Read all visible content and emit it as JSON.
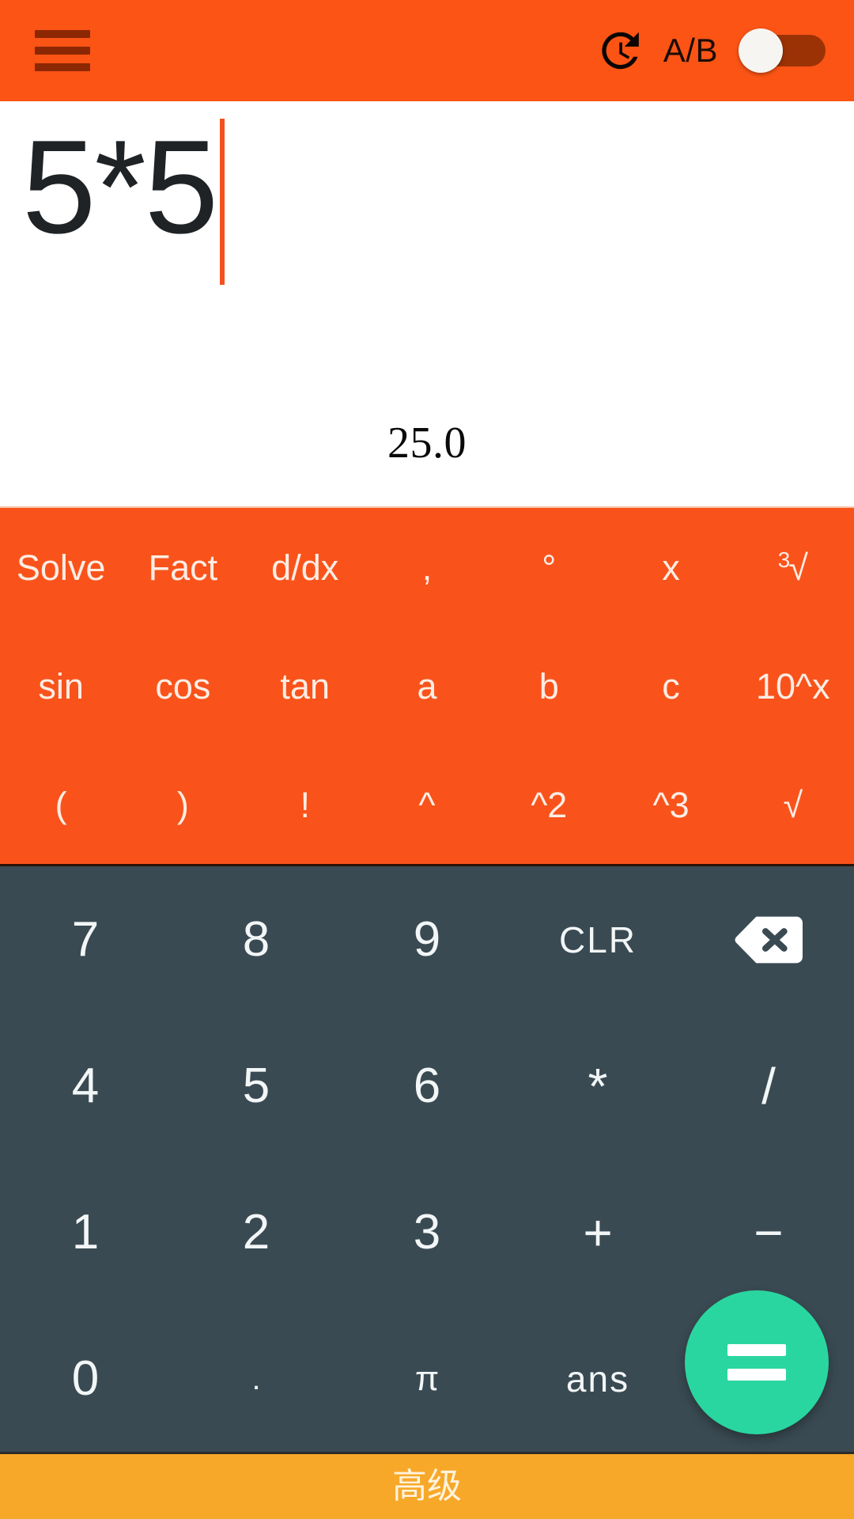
{
  "header": {
    "menu_icon": "hamburger-menu-icon",
    "history_icon": "history-clock-icon",
    "ab_label": "A/B",
    "toggle_state": "off",
    "background_color": "#FB5415",
    "menu_icon_color": "#8C2703",
    "toggle_track_color": "#9B3206",
    "toggle_thumb_color": "#F7F5F2"
  },
  "display": {
    "expression": "5*5",
    "result": "25.0",
    "caret_color": "#F4511E",
    "background_color": "#FFFFFF",
    "text_color": "#1F2326"
  },
  "function_pad": {
    "background_color": "#F9531B",
    "text_color": "#FDEDE4",
    "rows": [
      [
        {
          "label": "Solve",
          "name": "func-key-solve"
        },
        {
          "label": "Fact",
          "name": "func-key-fact"
        },
        {
          "label": "d/dx",
          "name": "func-key-ddx"
        },
        {
          "label": ",",
          "name": "func-key-comma"
        },
        {
          "label": "°",
          "name": "func-key-degree"
        },
        {
          "label": "x",
          "name": "func-key-x"
        },
        {
          "label": "√",
          "sup": "3",
          "name": "func-key-cube-root"
        }
      ],
      [
        {
          "label": "sin",
          "name": "func-key-sin"
        },
        {
          "label": "cos",
          "name": "func-key-cos"
        },
        {
          "label": "tan",
          "name": "func-key-tan"
        },
        {
          "label": "a",
          "name": "func-key-a"
        },
        {
          "label": "b",
          "name": "func-key-b"
        },
        {
          "label": "c",
          "name": "func-key-c"
        },
        {
          "label": "10^x",
          "name": "func-key-ten-pow-x"
        }
      ],
      [
        {
          "label": "(",
          "name": "func-key-open-paren"
        },
        {
          "label": ")",
          "name": "func-key-close-paren"
        },
        {
          "label": "!",
          "name": "func-key-factorial"
        },
        {
          "label": "^",
          "name": "func-key-caret"
        },
        {
          "label": "^2",
          "name": "func-key-square"
        },
        {
          "label": "^3",
          "name": "func-key-cube"
        },
        {
          "label": "√",
          "name": "func-key-square-root"
        }
      ]
    ]
  },
  "keypad": {
    "background_color": "#3A4A52",
    "text_color": "#F2F6F7",
    "rows": [
      [
        {
          "label": "7",
          "name": "key-7"
        },
        {
          "label": "8",
          "name": "key-8"
        },
        {
          "label": "9",
          "name": "key-9"
        },
        {
          "label": "CLR",
          "name": "key-clear"
        },
        {
          "label": "",
          "name": "key-backspace",
          "icon": "backspace-icon"
        }
      ],
      [
        {
          "label": "4",
          "name": "key-4"
        },
        {
          "label": "5",
          "name": "key-5"
        },
        {
          "label": "6",
          "name": "key-6"
        },
        {
          "label": "*",
          "name": "key-multiply"
        },
        {
          "label": "/",
          "name": "key-divide"
        }
      ],
      [
        {
          "label": "1",
          "name": "key-1"
        },
        {
          "label": "2",
          "name": "key-2"
        },
        {
          "label": "3",
          "name": "key-3"
        },
        {
          "label": "+",
          "name": "key-plus"
        },
        {
          "label": "−",
          "name": "key-minus"
        }
      ],
      [
        {
          "label": "0",
          "name": "key-0"
        },
        {
          "label": ".",
          "name": "key-decimal"
        },
        {
          "label": "π",
          "name": "key-pi"
        },
        {
          "label": "ans",
          "name": "key-ans"
        },
        {
          "label": "",
          "name": "key-equals-spacer"
        }
      ]
    ],
    "equals_button": {
      "icon": "equals-icon",
      "color": "#2AD6A0"
    }
  },
  "bottom_bar": {
    "label": "高级",
    "background_color": "#F7A829",
    "text_color": "#FFF3DD"
  }
}
